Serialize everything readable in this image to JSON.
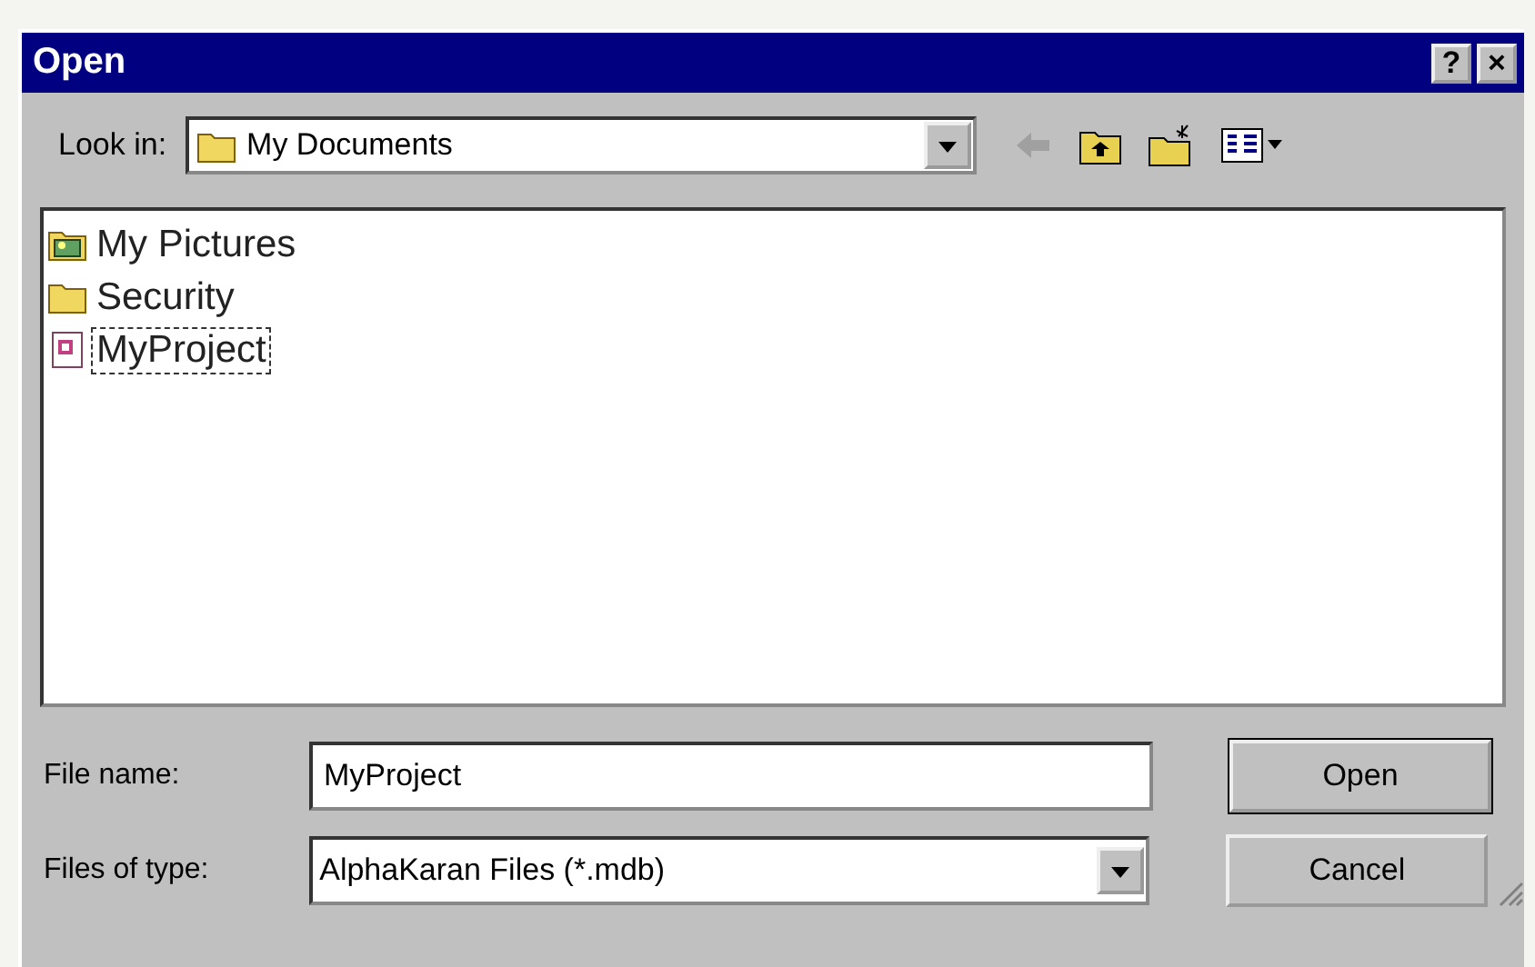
{
  "window": {
    "title": "Open",
    "title_buttons": [
      "?",
      "×"
    ]
  },
  "look_in": {
    "label": "Look in:",
    "value": "My Documents"
  },
  "files": [
    {
      "name": "My Pictures",
      "kind": "pictures",
      "selected": false
    },
    {
      "name": "Security",
      "kind": "folder",
      "selected": false
    },
    {
      "name": "MyProject",
      "kind": "database",
      "selected": true
    }
  ],
  "file_name": {
    "label": "File name:",
    "value": "MyProject"
  },
  "file_type": {
    "label": "Files of type:",
    "value": "AlphaKaran Files (*.mdb)"
  },
  "buttons": [
    "Open",
    "Cancel"
  ]
}
